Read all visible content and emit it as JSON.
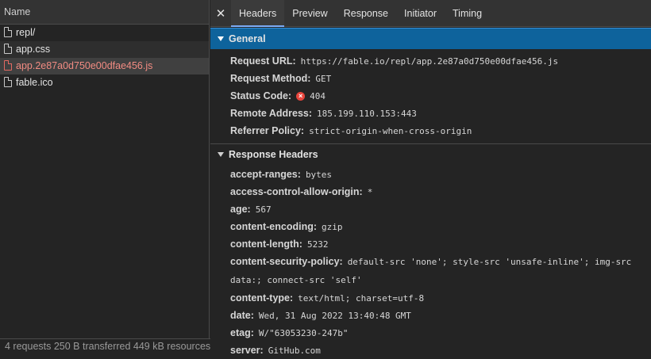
{
  "left_panel": {
    "header": "Name",
    "files": [
      {
        "name": "repl/",
        "state": "normal"
      },
      {
        "name": "app.css",
        "state": "normal"
      },
      {
        "name": "app.2e87a0d750e00dfae456.js",
        "state": "error"
      },
      {
        "name": "fable.ico",
        "state": "normal"
      }
    ],
    "footer": "4 requests 250 B transferred 449 kB resources"
  },
  "tabs": {
    "close_icon": "close-icon",
    "items": [
      "Headers",
      "Preview",
      "Response",
      "Initiator",
      "Timing"
    ],
    "active": "Headers"
  },
  "general": {
    "title": "General",
    "request_url": {
      "key": "Request URL:",
      "value": "https://fable.io/repl/app.2e87a0d750e00dfae456.js"
    },
    "request_method": {
      "key": "Request Method:",
      "value": "GET"
    },
    "status_code": {
      "key": "Status Code:",
      "value": "404",
      "icon": "error-icon"
    },
    "remote_address": {
      "key": "Remote Address:",
      "value": "185.199.110.153:443"
    },
    "referrer_policy": {
      "key": "Referrer Policy:",
      "value": "strict-origin-when-cross-origin"
    }
  },
  "response_headers": {
    "title": "Response Headers",
    "items": [
      {
        "key": "accept-ranges:",
        "value": "bytes"
      },
      {
        "key": "access-control-allow-origin:",
        "value": "*"
      },
      {
        "key": "age:",
        "value": "567"
      },
      {
        "key": "content-encoding:",
        "value": "gzip"
      },
      {
        "key": "content-length:",
        "value": "5232"
      },
      {
        "key": "content-security-policy:",
        "value": "default-src 'none'; style-src 'unsafe-inline'; img-src data:; connect-src 'self'"
      },
      {
        "key": "content-type:",
        "value": "text/html; charset=utf-8"
      },
      {
        "key": "date:",
        "value": "Wed, 31 Aug 2022 13:40:48 GMT"
      },
      {
        "key": "etag:",
        "value": "W/\"63053230-247b\""
      },
      {
        "key": "server:",
        "value": "GitHub.com"
      }
    ]
  },
  "colors": {
    "accent": "#0e639c",
    "tab_underline": "#7cacf8",
    "error": "#e8453c"
  }
}
